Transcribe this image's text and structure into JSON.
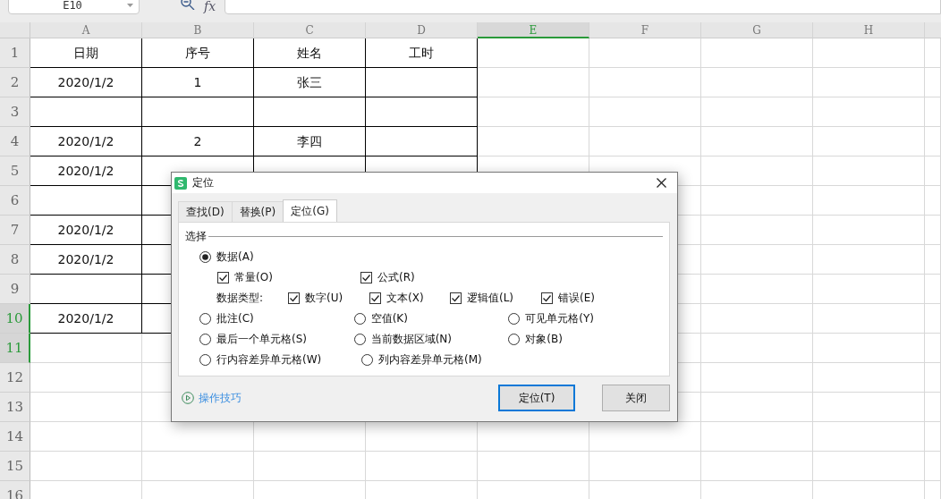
{
  "formula_bar": {
    "name_box": "E10",
    "function_label": "fx"
  },
  "columns": [
    {
      "label": "A",
      "selected": false
    },
    {
      "label": "B",
      "selected": false
    },
    {
      "label": "C",
      "selected": false
    },
    {
      "label": "D",
      "selected": false
    },
    {
      "label": "E",
      "selected": true
    },
    {
      "label": "F",
      "selected": false
    },
    {
      "label": "G",
      "selected": false
    },
    {
      "label": "H",
      "selected": false
    }
  ],
  "rows": [
    {
      "label": "1",
      "selected": false,
      "cells": [
        "日期",
        "序号",
        "姓名",
        "工时"
      ]
    },
    {
      "label": "2",
      "selected": false,
      "cells": [
        "2020/1/2",
        "1",
        "张三",
        null
      ]
    },
    {
      "label": "3",
      "selected": false,
      "cells": [
        null,
        null,
        null,
        null
      ]
    },
    {
      "label": "4",
      "selected": false,
      "cells": [
        "2020/1/2",
        "2",
        "李四",
        null
      ]
    },
    {
      "label": "5",
      "selected": false,
      "cells": [
        "2020/1/2",
        null,
        null,
        null
      ]
    },
    {
      "label": "6",
      "selected": false,
      "cells": [
        null,
        null,
        null,
        null
      ]
    },
    {
      "label": "7",
      "selected": false,
      "cells": [
        "2020/1/2",
        null,
        null,
        null
      ]
    },
    {
      "label": "8",
      "selected": false,
      "cells": [
        "2020/1/2",
        null,
        null,
        null
      ]
    },
    {
      "label": "9",
      "selected": false,
      "cells": [
        null,
        null,
        null,
        null
      ]
    },
    {
      "label": "10",
      "selected": true,
      "cells": [
        "2020/1/2",
        null,
        null,
        null
      ]
    },
    {
      "label": "11",
      "selected": true
    },
    {
      "label": "12",
      "selected": false
    },
    {
      "label": "13",
      "selected": false
    },
    {
      "label": "14",
      "selected": false
    },
    {
      "label": "15",
      "selected": false
    },
    {
      "label": "16",
      "selected": false
    }
  ],
  "dialog": {
    "title": "定位",
    "tabs": [
      {
        "label": "查找(D)",
        "selected": false
      },
      {
        "label": "替换(P)",
        "selected": false
      },
      {
        "label": "定位(G)",
        "selected": true
      }
    ],
    "group_label": "选择",
    "lines": [
      {
        "kind": "radio-row",
        "items": [
          {
            "kind": "radio",
            "label": "数据(A)",
            "selected": true
          }
        ]
      },
      {
        "kind": "check-row",
        "items": [
          {
            "kind": "checkbox",
            "label": "常量(O)",
            "checked": true
          },
          {
            "kind": "checkbox",
            "label": "公式(R)",
            "checked": true
          }
        ]
      },
      {
        "kind": "type-row",
        "items": [
          {
            "kind": "label",
            "label": "数据类型:"
          },
          {
            "kind": "checkbox",
            "label": "数字(U)",
            "checked": true
          },
          {
            "kind": "checkbox",
            "label": "文本(X)",
            "checked": true
          },
          {
            "kind": "checkbox",
            "label": "逻辑值(L)",
            "checked": true
          },
          {
            "kind": "checkbox",
            "label": "错误(E)",
            "checked": true
          }
        ]
      },
      {
        "kind": "radio-row",
        "items": [
          {
            "kind": "radio",
            "label": "批注(C)",
            "selected": false
          },
          {
            "kind": "radio",
            "label": "空值(K)",
            "selected": false
          },
          {
            "kind": "radio",
            "label": "可见单元格(Y)",
            "selected": false
          }
        ]
      },
      {
        "kind": "radio-row",
        "items": [
          {
            "kind": "radio",
            "label": "最后一个单元格(S)",
            "selected": false
          },
          {
            "kind": "radio",
            "label": "当前数据区域(N)",
            "selected": false
          },
          {
            "kind": "radio",
            "label": "对象(B)",
            "selected": false
          }
        ]
      },
      {
        "kind": "radio-row",
        "items": [
          {
            "kind": "radio",
            "label": "行内容差异单元格(W)",
            "selected": false
          },
          {
            "kind": "radio",
            "label": "列内容差异单元格(M)",
            "selected": false
          }
        ]
      }
    ],
    "tips_link": "操作技巧",
    "buttons": [
      {
        "label": "定位(T)",
        "selected": true
      },
      {
        "label": "关闭",
        "selected": false
      }
    ]
  }
}
